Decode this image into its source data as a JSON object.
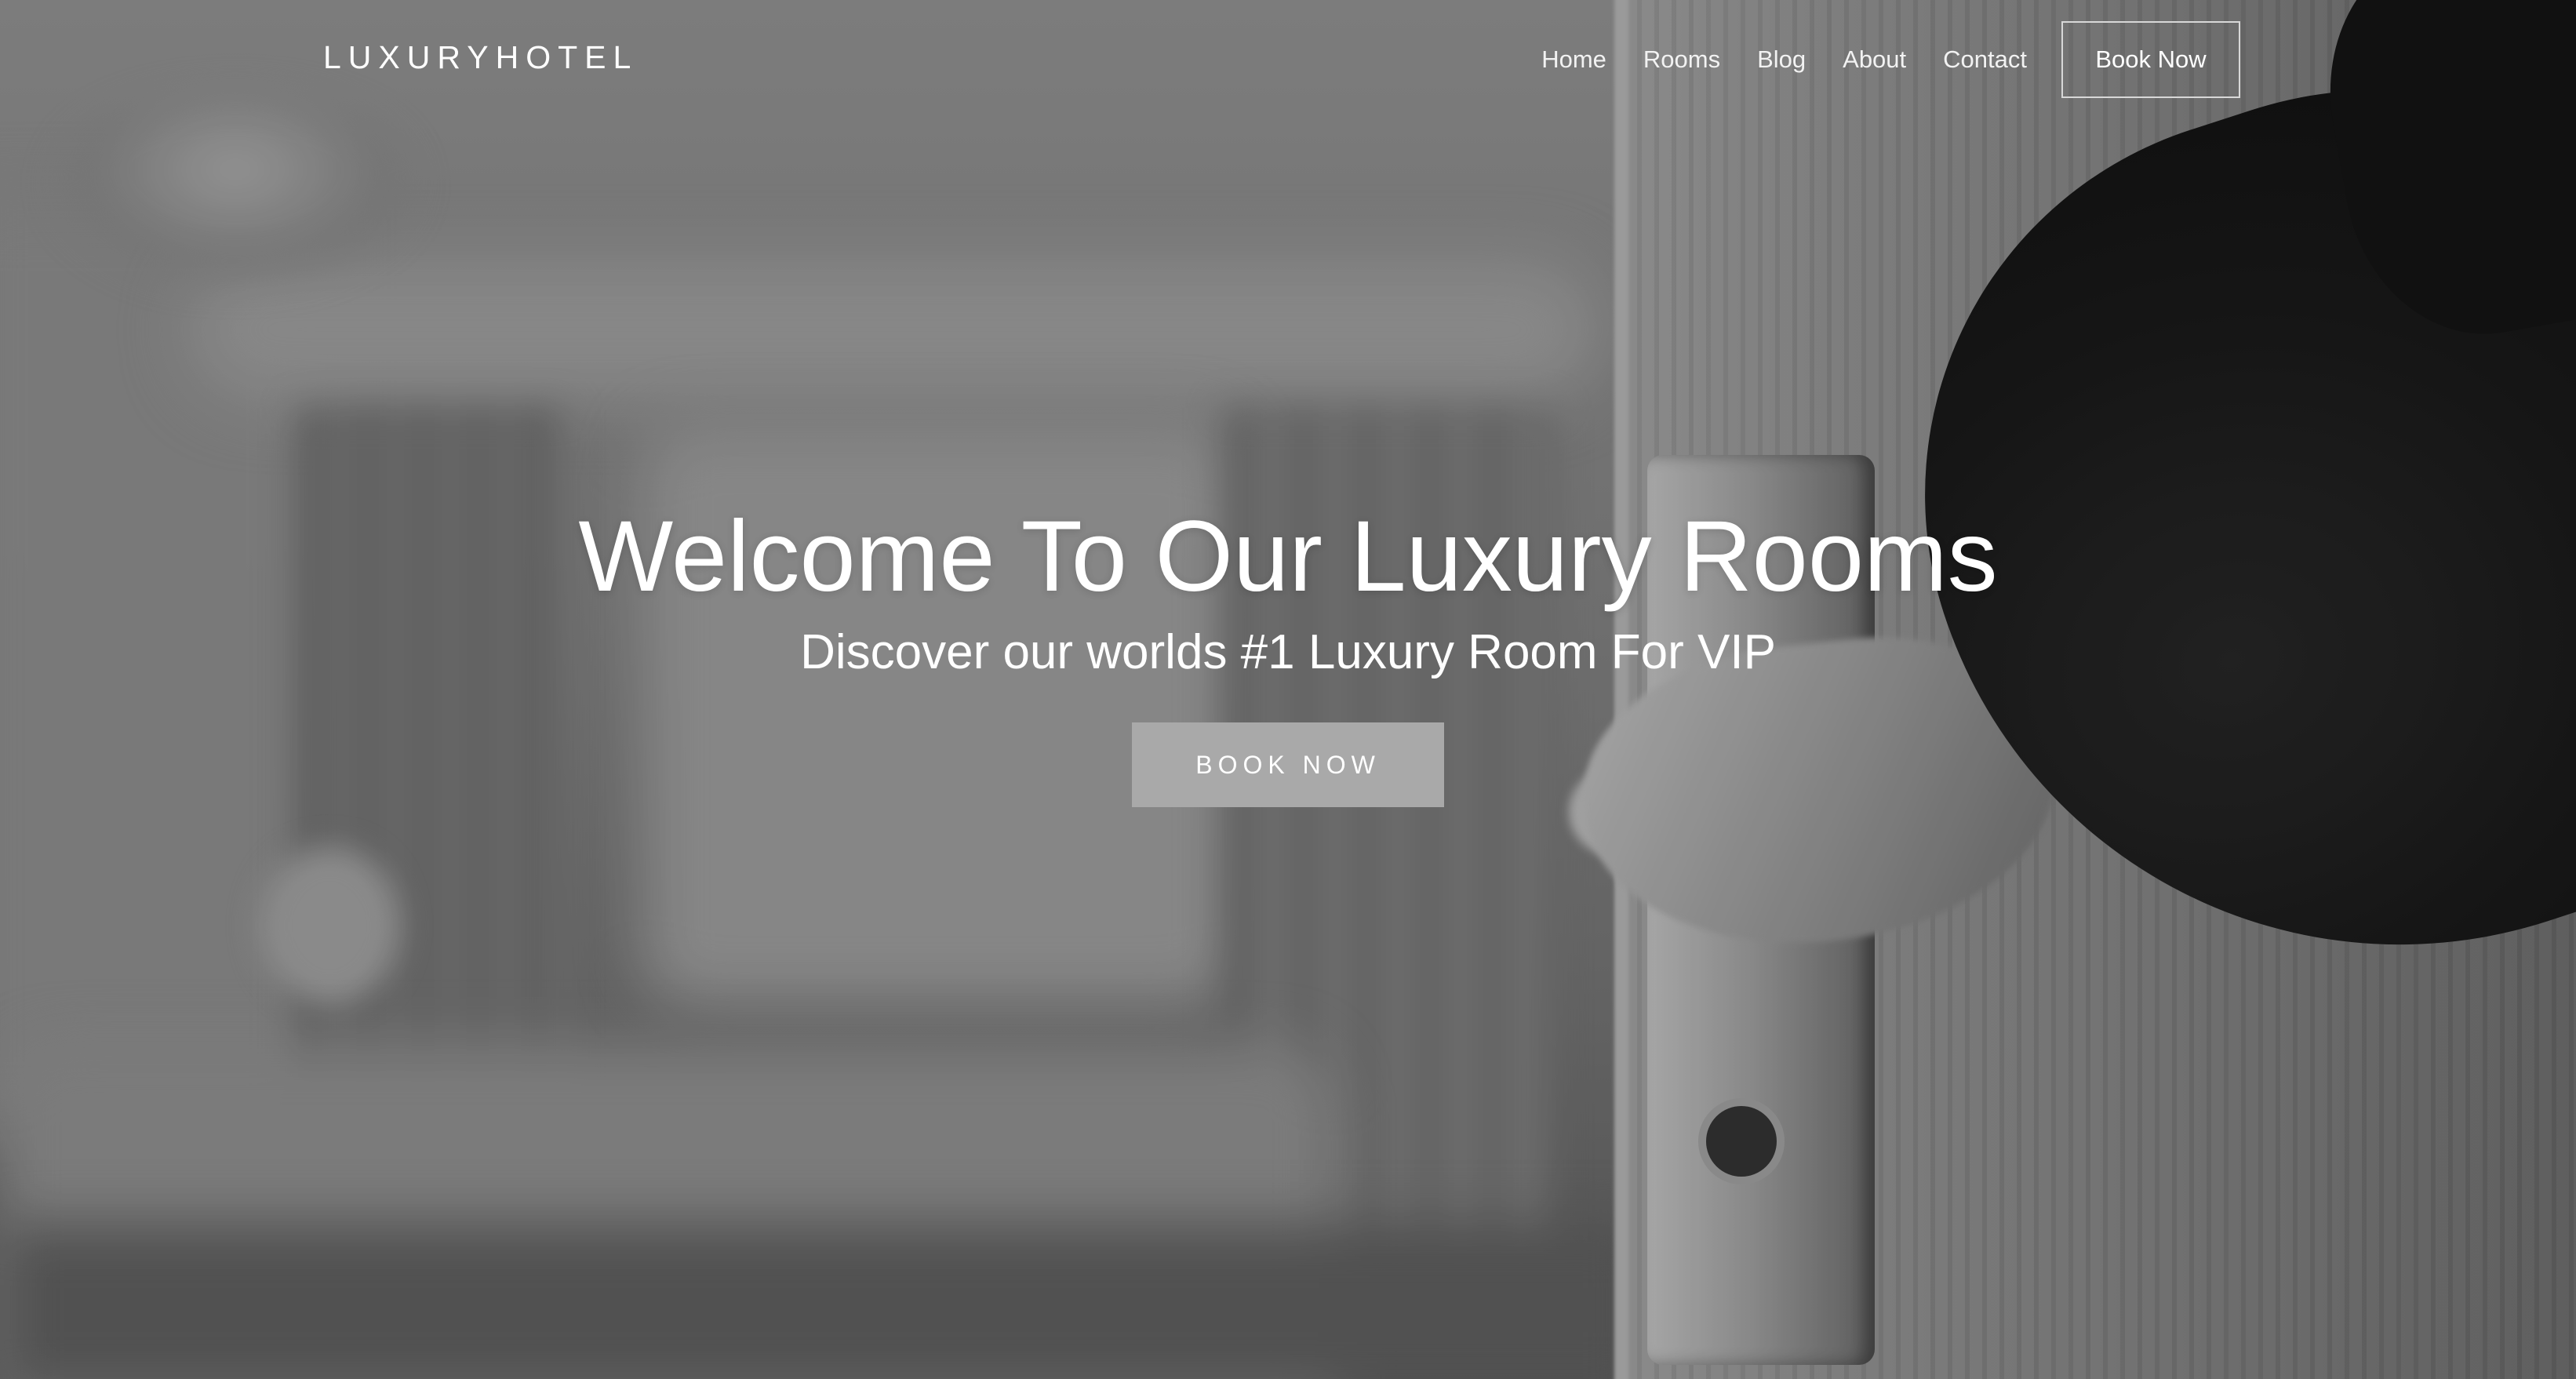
{
  "brand": {
    "name": "LUXURYHOTEL"
  },
  "nav": {
    "items": [
      {
        "label": "Home"
      },
      {
        "label": "Rooms"
      },
      {
        "label": "Blog"
      },
      {
        "label": "About"
      },
      {
        "label": "Contact"
      }
    ],
    "cta_label": "Book Now"
  },
  "hero": {
    "title": "Welcome To Our Luxury Rooms",
    "subtitle": "Discover our worlds #1 Luxury Room For VIP",
    "cta_label": "BOOK NOW",
    "background": "hotel-door-photo"
  },
  "colors": {
    "text": "#ffffff",
    "cta_background": "#a9a9a9",
    "outline": "#d8d8d8"
  }
}
